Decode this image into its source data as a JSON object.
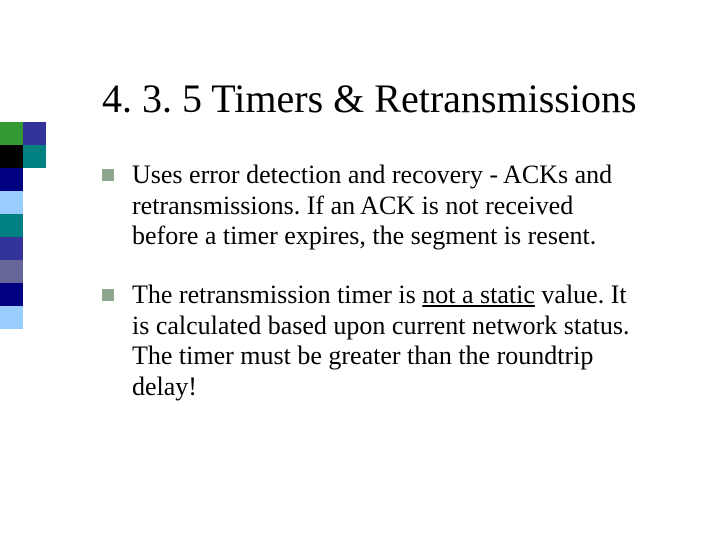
{
  "slide": {
    "title": "4. 3. 5 Timers & Retransmissions",
    "bullets": [
      {
        "pre": "Uses error detection and recovery - ACKs and retransmissions. If an ACK is not received before a timer expires, the segment is resent.",
        "underlined": "",
        "post": ""
      },
      {
        "pre": "The retransmission timer is ",
        "underlined": "not a static",
        "post": " value. It is calculated based upon current network status. The timer must be greater than the roundtrip delay!"
      }
    ]
  }
}
